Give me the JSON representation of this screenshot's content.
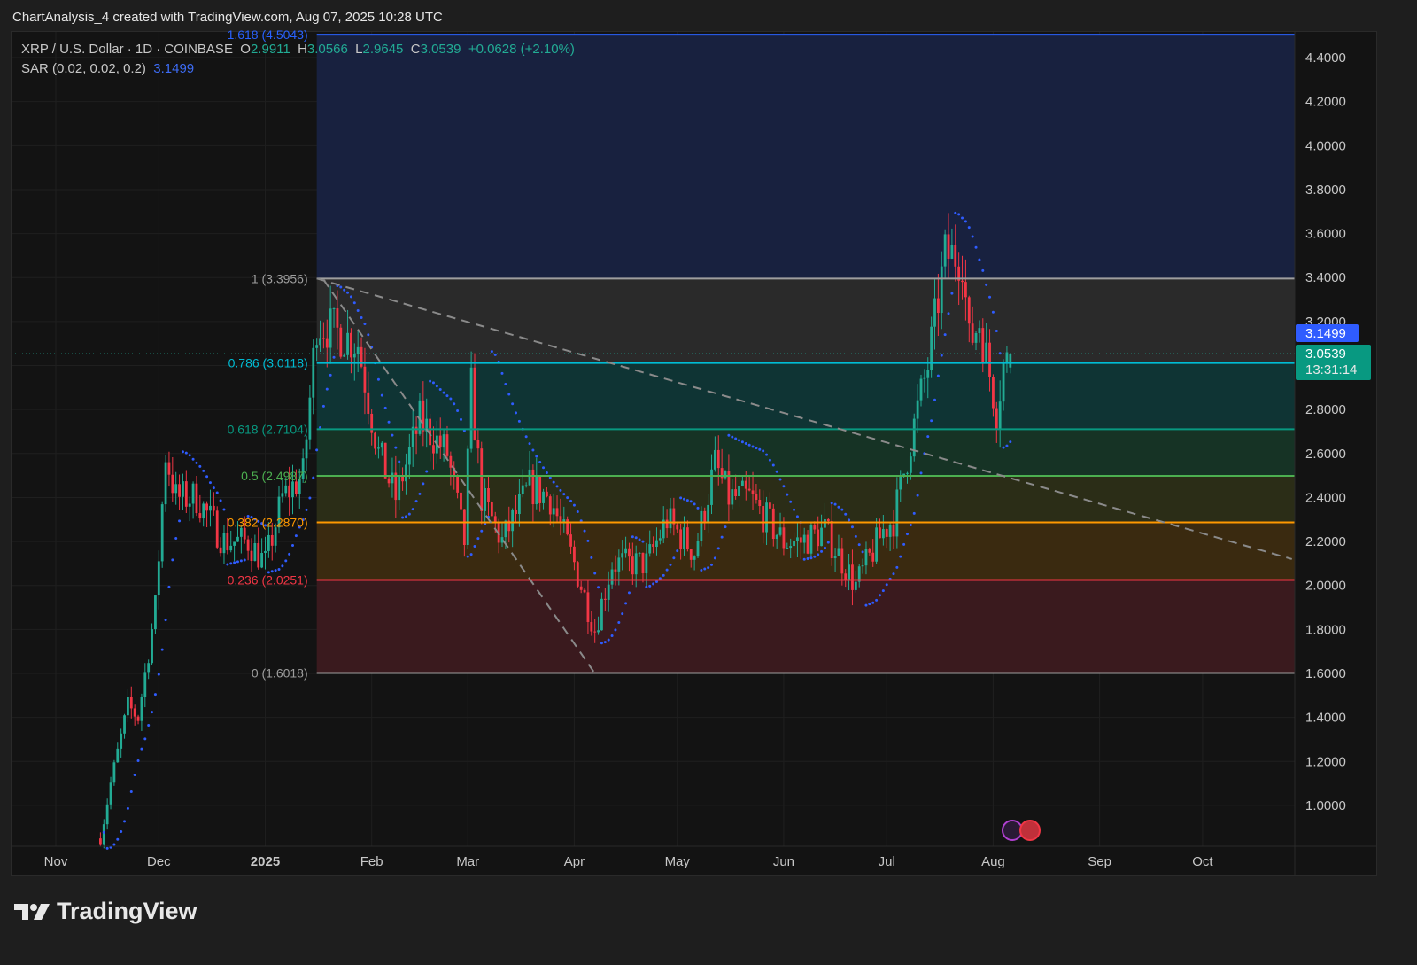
{
  "header": {
    "title": "ChartAnalysis_4 created with TradingView.com, Aug 07, 2025 10:28 UTC"
  },
  "legend": {
    "symbol": "XRP / U.S. Dollar · 1D · COINBASE",
    "o_label": "O",
    "o": "2.9911",
    "h_label": "H",
    "h": "3.0566",
    "l_label": "L",
    "l": "2.9645",
    "c_label": "C",
    "c": "3.0539",
    "change": "+0.0628 (+2.10%)",
    "sar_label": "SAR (0.02, 0.02, 0.2)",
    "sar_value": "3.1499"
  },
  "price_tags": {
    "sar": "3.1499",
    "last": "3.0539",
    "countdown": "13:31:14"
  },
  "footer": {
    "brand": "TradingView"
  },
  "colors": {
    "up": "#22ab94",
    "down": "#f23645",
    "sar": "#2f5cff"
  },
  "chart_data": {
    "type": "candlestick",
    "title": "XRP / U.S. Dollar · 1D · COINBASE",
    "ylim": [
      0.85,
      4.55
    ],
    "y_ticks": [
      "1.0000",
      "1.2000",
      "1.4000",
      "1.6000",
      "1.8000",
      "2.0000",
      "2.2000",
      "2.4000",
      "2.6000",
      "2.8000",
      "3.0000",
      "3.2000",
      "3.4000",
      "3.6000",
      "3.8000",
      "4.0000",
      "4.2000",
      "4.4000"
    ],
    "x_ticks": [
      {
        "label": "Nov",
        "date": "2024-11-01"
      },
      {
        "label": "Dec",
        "date": "2024-12-01"
      },
      {
        "label": "2025",
        "date": "2025-01-01"
      },
      {
        "label": "Feb",
        "date": "2025-02-01"
      },
      {
        "label": "Mar",
        "date": "2025-03-01"
      },
      {
        "label": "Apr",
        "date": "2025-04-01"
      },
      {
        "label": "May",
        "date": "2025-05-01"
      },
      {
        "label": "Jun",
        "date": "2025-06-01"
      },
      {
        "label": "Jul",
        "date": "2025-07-01"
      },
      {
        "label": "Aug",
        "date": "2025-08-01"
      },
      {
        "label": "Sep",
        "date": "2025-09-01"
      },
      {
        "label": "Oct",
        "date": "2025-10-01"
      }
    ],
    "approx_close_path": [
      [
        "2024-11-14",
        0.85
      ],
      [
        "2024-11-17",
        1.1
      ],
      [
        "2024-11-22",
        1.45
      ],
      [
        "2024-11-25",
        1.4
      ],
      [
        "2024-11-30",
        1.9
      ],
      [
        "2024-12-03",
        2.6
      ],
      [
        "2024-12-06",
        2.4
      ],
      [
        "2024-12-12",
        2.4
      ],
      [
        "2024-12-20",
        2.2
      ],
      [
        "2024-12-27",
        2.2
      ],
      [
        "2025-01-01",
        2.1
      ],
      [
        "2025-01-06",
        2.4
      ],
      [
        "2025-01-12",
        2.5
      ],
      [
        "2025-01-16",
        3.2
      ],
      [
        "2025-01-22",
        3.15
      ],
      [
        "2025-01-28",
        3.1
      ],
      [
        "2025-02-03",
        2.6
      ],
      [
        "2025-02-08",
        2.4
      ],
      [
        "2025-02-15",
        2.75
      ],
      [
        "2025-02-23",
        2.6
      ],
      [
        "2025-02-28",
        2.2
      ],
      [
        "2025-03-02",
        2.9
      ],
      [
        "2025-03-05",
        2.4
      ],
      [
        "2025-03-11",
        2.2
      ],
      [
        "2025-03-19",
        2.45
      ],
      [
        "2025-03-25",
        2.4
      ],
      [
        "2025-04-01",
        2.1
      ],
      [
        "2025-04-07",
        1.8
      ],
      [
        "2025-04-12",
        2.1
      ],
      [
        "2025-04-22",
        2.1
      ],
      [
        "2025-04-28",
        2.3
      ],
      [
        "2025-05-06",
        2.15
      ],
      [
        "2025-05-12",
        2.55
      ],
      [
        "2025-05-16",
        2.4
      ],
      [
        "2025-05-22",
        2.4
      ],
      [
        "2025-06-01",
        2.2
      ],
      [
        "2025-06-06",
        2.2
      ],
      [
        "2025-06-13",
        2.25
      ],
      [
        "2025-06-22",
        2.0
      ],
      [
        "2025-06-30",
        2.25
      ],
      [
        "2025-07-03",
        2.3
      ],
      [
        "2025-07-10",
        2.8
      ],
      [
        "2025-07-13",
        3.0
      ],
      [
        "2025-07-18",
        3.5
      ],
      [
        "2025-07-23",
        3.5
      ],
      [
        "2025-07-25",
        3.1
      ],
      [
        "2025-07-28",
        3.2
      ],
      [
        "2025-08-02",
        2.8
      ],
      [
        "2025-08-04",
        3.0
      ],
      [
        "2025-08-07",
        3.0539
      ]
    ],
    "fib_levels": [
      {
        "ratio": "0",
        "price": 1.6018,
        "label": "0 (1.6018)",
        "color": "#9e9e9e"
      },
      {
        "ratio": "0.236",
        "price": 2.0251,
        "label": "0.236 (2.0251)",
        "color": "#f23645"
      },
      {
        "ratio": "0.382",
        "price": 2.287,
        "label": "0.382 (2.2870)",
        "color": "#ff9800"
      },
      {
        "ratio": "0.5",
        "price": 2.4987,
        "label": "0.5 (2.4987)",
        "color": "#4caf50"
      },
      {
        "ratio": "0.618",
        "price": 2.7104,
        "label": "0.618 (2.7104)",
        "color": "#089981"
      },
      {
        "ratio": "0.786",
        "price": 3.0118,
        "label": "0.786 (3.0118)",
        "color": "#00bcd4"
      },
      {
        "ratio": "1",
        "price": 3.3956,
        "label": "1 (3.3956)",
        "color": "#9e9e9e"
      },
      {
        "ratio": "1.618",
        "price": 4.5043,
        "label": "1.618 (4.5043)",
        "color": "#2962ff"
      }
    ],
    "fib_start_date": "2025-01-16",
    "trendlines": [
      {
        "from": [
          "2025-01-16",
          3.3956
        ],
        "to": [
          "2025-10-27",
          2.12
        ]
      },
      {
        "from": [
          "2025-01-18",
          3.39
        ],
        "to": [
          "2025-04-07",
          1.6
        ]
      }
    ],
    "indicator": {
      "name": "Parabolic SAR",
      "params": "0.02, 0.02, 0.2",
      "last": 3.1499
    }
  }
}
